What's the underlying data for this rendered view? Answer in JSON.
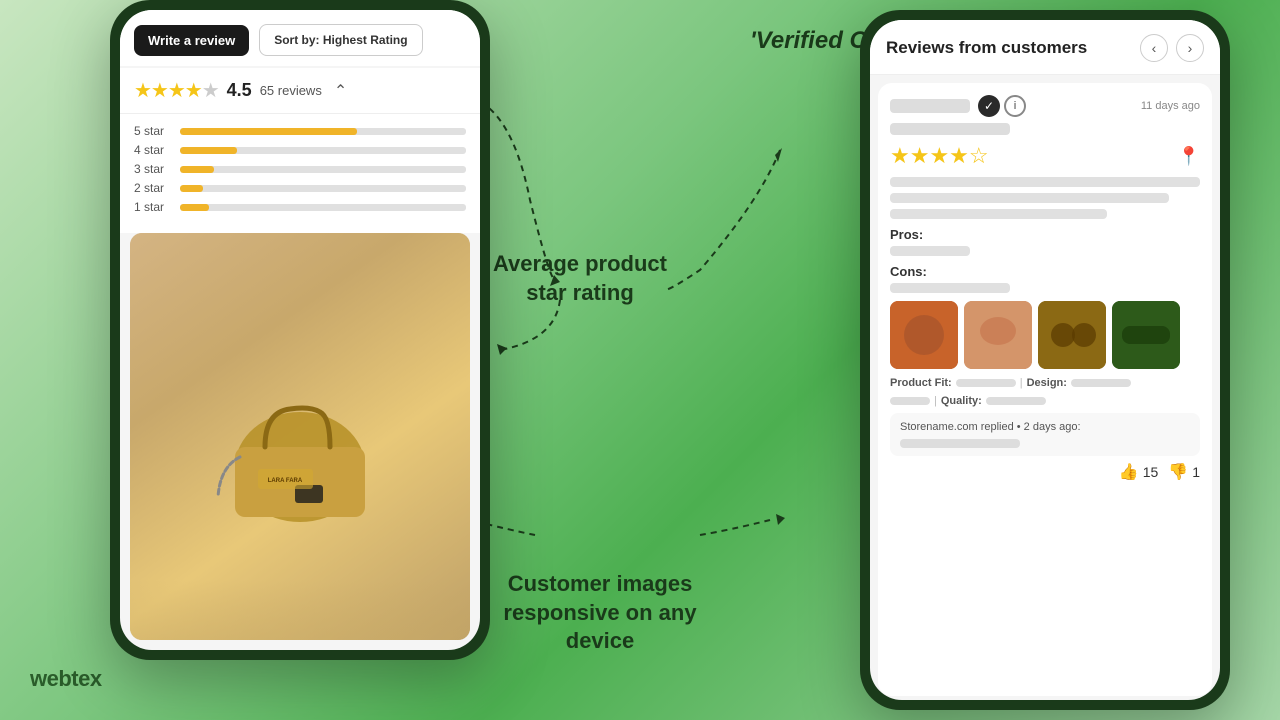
{
  "logo": {
    "text": "webtex"
  },
  "annotations": {
    "badge": "'Verified Customer' badge",
    "avg_rating": "Average product\nstar rating",
    "customer_images": "Customer images\nresponsive on any\ndevice"
  },
  "left_phone": {
    "write_review_btn": "Write a review",
    "sort_label": "Sort by:",
    "sort_value": "Highest Rating",
    "rating": "4.5",
    "reviews_count": "65 reviews",
    "star_bars": [
      {
        "label": "5 star",
        "pct": 62
      },
      {
        "label": "4 star",
        "pct": 20
      },
      {
        "label": "3 star",
        "pct": 12
      },
      {
        "label": "2 star",
        "pct": 8
      },
      {
        "label": "1 star",
        "pct": 10
      }
    ]
  },
  "right_phone": {
    "header_title": "Reviews from customers",
    "nav_prev": "‹",
    "nav_next": "›",
    "review": {
      "time_ago": "11 days ago",
      "stars": "★★★★☆",
      "pros_label": "Pros:",
      "cons_label": "Cons:",
      "product_fit_label": "Product Fit:",
      "design_label": "Design:",
      "quality_label": "Quality:",
      "reply_text": "Storename.com replied • 2 days ago:",
      "helpful_count": "15",
      "unhelpful_count": "1"
    }
  }
}
